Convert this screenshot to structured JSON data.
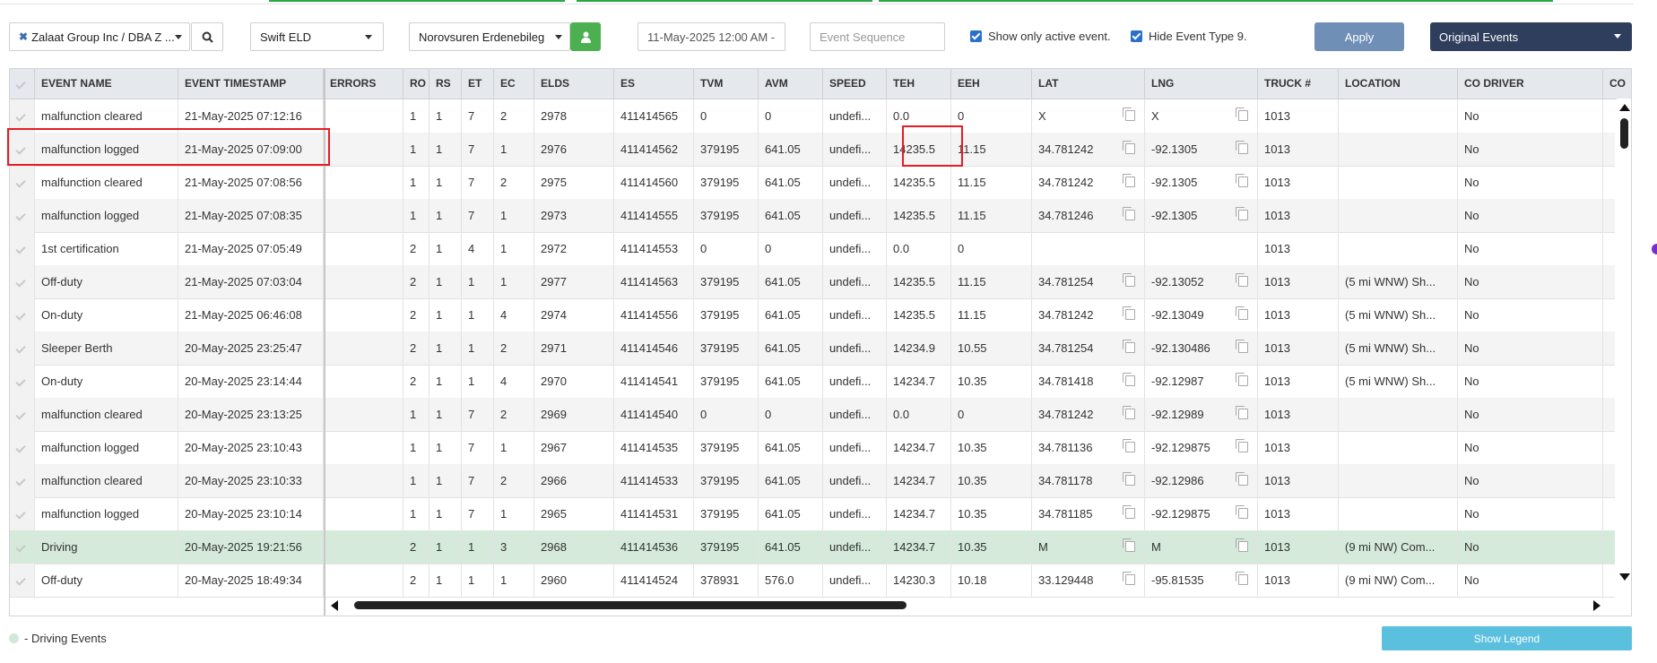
{
  "filters": {
    "company": "Zalaat Group Inc / DBA Z ...",
    "eld_provider": "Swift ELD",
    "driver": "Norovsuren Erdenebileg",
    "date_from": "11-May-2025 12:00 AM -",
    "event_sequence_placeholder": "Event Sequence",
    "show_active_label": "Show only active event.",
    "hide_type9_label": "Hide Event Type 9.",
    "apply_label": "Apply",
    "event_mode": "Original Events"
  },
  "colors": {
    "apply_bg": "#6f8fb6",
    "mode_bg": "#2e3e5c",
    "driver_btn_bg": "#4caf50",
    "driving_row": "#d5eadb",
    "legend_btn_bg": "#5bc0de",
    "highlight": "#e51c23"
  },
  "table": {
    "columns": [
      "EVENT NAME",
      "EVENT TIMESTAMP",
      "ERRORS",
      "RO",
      "RS",
      "ET",
      "EC",
      "ELDS",
      "ES",
      "TVM",
      "AVM",
      "SPEED",
      "TEH",
      "EEH",
      "LAT",
      "LNG",
      "TRUCK #",
      "LOCATION",
      "CO DRIVER",
      "CO"
    ],
    "rows": [
      {
        "name": "malfunction cleared",
        "ts": "21-May-2025 07:12:16",
        "errors": "",
        "ro": "1",
        "rs": "1",
        "et": "7",
        "ec": "2",
        "elds": "2978",
        "es": "411414565",
        "tvm": "0",
        "avm": "0",
        "speed": "undefi...",
        "teh": "0.0",
        "eeh": "0",
        "lat": "X",
        "lng": "X",
        "truck": "1013",
        "location": "",
        "codriver": "No",
        "driving": false
      },
      {
        "name": "malfunction logged",
        "ts": "21-May-2025 07:09:00",
        "errors": "",
        "ro": "1",
        "rs": "1",
        "et": "7",
        "ec": "1",
        "elds": "2976",
        "es": "411414562",
        "tvm": "379195",
        "avm": "641.05",
        "speed": "undefi...",
        "teh": "14235.5",
        "eeh": "11.15",
        "lat": "34.781242",
        "lng": "-92.1305",
        "truck": "1013",
        "location": "",
        "codriver": "No",
        "driving": false
      },
      {
        "name": "malfunction cleared",
        "ts": "21-May-2025 07:08:56",
        "errors": "",
        "ro": "1",
        "rs": "1",
        "et": "7",
        "ec": "2",
        "elds": "2975",
        "es": "411414560",
        "tvm": "379195",
        "avm": "641.05",
        "speed": "undefi...",
        "teh": "14235.5",
        "eeh": "11.15",
        "lat": "34.781242",
        "lng": "-92.1305",
        "truck": "1013",
        "location": "",
        "codriver": "No",
        "driving": false
      },
      {
        "name": "malfunction logged",
        "ts": "21-May-2025 07:08:35",
        "errors": "",
        "ro": "1",
        "rs": "1",
        "et": "7",
        "ec": "1",
        "elds": "2973",
        "es": "411414555",
        "tvm": "379195",
        "avm": "641.05",
        "speed": "undefi...",
        "teh": "14235.5",
        "eeh": "11.15",
        "lat": "34.781246",
        "lng": "-92.1305",
        "truck": "1013",
        "location": "",
        "codriver": "No",
        "driving": false
      },
      {
        "name": "1st certification",
        "ts": "21-May-2025 07:05:49",
        "errors": "",
        "ro": "2",
        "rs": "1",
        "et": "4",
        "ec": "1",
        "elds": "2972",
        "es": "411414553",
        "tvm": "0",
        "avm": "0",
        "speed": "undefi...",
        "teh": "0.0",
        "eeh": "0",
        "lat": "",
        "lng": "",
        "truck": "1013",
        "location": "",
        "codriver": "No",
        "driving": false
      },
      {
        "name": "Off-duty",
        "ts": "21-May-2025 07:03:04",
        "errors": "",
        "ro": "2",
        "rs": "1",
        "et": "1",
        "ec": "1",
        "elds": "2977",
        "es": "411414563",
        "tvm": "379195",
        "avm": "641.05",
        "speed": "undefi...",
        "teh": "14235.5",
        "eeh": "11.15",
        "lat": "34.781254",
        "lng": "-92.13052",
        "truck": "1013",
        "location": "(5 mi WNW) Sh...",
        "codriver": "No",
        "driving": false
      },
      {
        "name": "On-duty",
        "ts": "21-May-2025 06:46:08",
        "errors": "",
        "ro": "2",
        "rs": "1",
        "et": "1",
        "ec": "4",
        "elds": "2974",
        "es": "411414556",
        "tvm": "379195",
        "avm": "641.05",
        "speed": "undefi...",
        "teh": "14235.5",
        "eeh": "11.15",
        "lat": "34.781242",
        "lng": "-92.13049",
        "truck": "1013",
        "location": "(5 mi WNW) Sh...",
        "codriver": "No",
        "driving": false
      },
      {
        "name": "Sleeper Berth",
        "ts": "20-May-2025 23:25:47",
        "errors": "",
        "ro": "2",
        "rs": "1",
        "et": "1",
        "ec": "2",
        "elds": "2971",
        "es": "411414546",
        "tvm": "379195",
        "avm": "641.05",
        "speed": "undefi...",
        "teh": "14234.9",
        "eeh": "10.55",
        "lat": "34.781254",
        "lng": "-92.130486",
        "truck": "1013",
        "location": "(5 mi WNW) Sh...",
        "codriver": "No",
        "driving": false
      },
      {
        "name": "On-duty",
        "ts": "20-May-2025 23:14:44",
        "errors": "",
        "ro": "2",
        "rs": "1",
        "et": "1",
        "ec": "4",
        "elds": "2970",
        "es": "411414541",
        "tvm": "379195",
        "avm": "641.05",
        "speed": "undefi...",
        "teh": "14234.7",
        "eeh": "10.35",
        "lat": "34.781418",
        "lng": "-92.12987",
        "truck": "1013",
        "location": "(5 mi WNW) Sh...",
        "codriver": "No",
        "driving": false
      },
      {
        "name": "malfunction cleared",
        "ts": "20-May-2025 23:13:25",
        "errors": "",
        "ro": "1",
        "rs": "1",
        "et": "7",
        "ec": "2",
        "elds": "2969",
        "es": "411414540",
        "tvm": "0",
        "avm": "0",
        "speed": "undefi...",
        "teh": "0.0",
        "eeh": "0",
        "lat": "34.781242",
        "lng": "-92.12989",
        "truck": "1013",
        "location": "",
        "codriver": "No",
        "driving": false
      },
      {
        "name": "malfunction logged",
        "ts": "20-May-2025 23:10:43",
        "errors": "",
        "ro": "1",
        "rs": "1",
        "et": "7",
        "ec": "1",
        "elds": "2967",
        "es": "411414535",
        "tvm": "379195",
        "avm": "641.05",
        "speed": "undefi...",
        "teh": "14234.7",
        "eeh": "10.35",
        "lat": "34.781136",
        "lng": "-92.129875",
        "truck": "1013",
        "location": "",
        "codriver": "No",
        "driving": false
      },
      {
        "name": "malfunction cleared",
        "ts": "20-May-2025 23:10:33",
        "errors": "",
        "ro": "1",
        "rs": "1",
        "et": "7",
        "ec": "2",
        "elds": "2966",
        "es": "411414533",
        "tvm": "379195",
        "avm": "641.05",
        "speed": "undefi...",
        "teh": "14234.7",
        "eeh": "10.35",
        "lat": "34.781178",
        "lng": "-92.12986",
        "truck": "1013",
        "location": "",
        "codriver": "No",
        "driving": false
      },
      {
        "name": "malfunction logged",
        "ts": "20-May-2025 23:10:14",
        "errors": "",
        "ro": "1",
        "rs": "1",
        "et": "7",
        "ec": "1",
        "elds": "2965",
        "es": "411414531",
        "tvm": "379195",
        "avm": "641.05",
        "speed": "undefi...",
        "teh": "14234.7",
        "eeh": "10.35",
        "lat": "34.781185",
        "lng": "-92.129875",
        "truck": "1013",
        "location": "",
        "codriver": "No",
        "driving": false
      },
      {
        "name": "Driving",
        "ts": "20-May-2025 19:21:56",
        "errors": "",
        "ro": "2",
        "rs": "1",
        "et": "1",
        "ec": "3",
        "elds": "2968",
        "es": "411414536",
        "tvm": "379195",
        "avm": "641.05",
        "speed": "undefi...",
        "teh": "14234.7",
        "eeh": "10.35",
        "lat": "M",
        "lng": "M",
        "truck": "1013",
        "location": "(9 mi NW) Com...",
        "codriver": "No",
        "driving": true
      },
      {
        "name": "Off-duty",
        "ts": "20-May-2025 18:49:34",
        "errors": "",
        "ro": "2",
        "rs": "1",
        "et": "1",
        "ec": "1",
        "elds": "2960",
        "es": "411414524",
        "tvm": "378931",
        "avm": "576.0",
        "speed": "undefi...",
        "teh": "14230.3",
        "eeh": "10.18",
        "lat": "33.129448",
        "lng": "-95.81535",
        "truck": "1013",
        "location": "(9 mi NW) Com...",
        "codriver": "No",
        "driving": false
      }
    ]
  },
  "legend": {
    "driving_label": "- Driving Events",
    "show_legend_label": "Show Legend"
  }
}
